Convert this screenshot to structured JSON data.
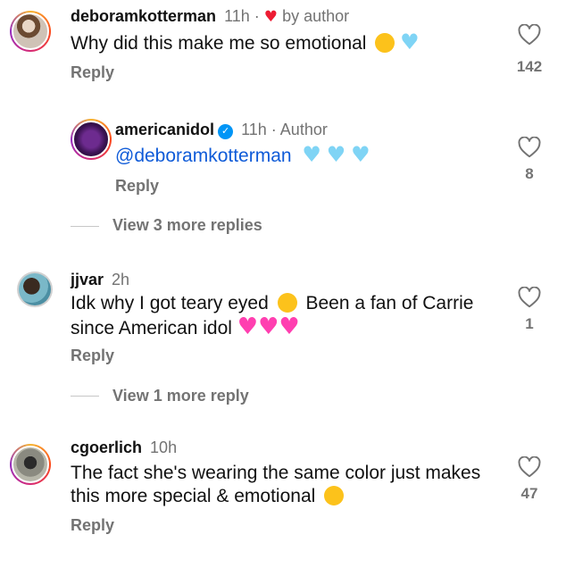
{
  "comments": [
    {
      "username": "deboramkotterman",
      "time": "11h",
      "author_tag": "by author",
      "text": "Why did this make me so emotional",
      "reply": "Reply",
      "likes": "142"
    },
    {
      "username": "americanidol",
      "time": "11h",
      "author_tag": "Author",
      "text": "@deboramkotterman",
      "reply": "Reply",
      "likes": "8",
      "verified": true
    },
    {
      "username": "jjvar",
      "time": "2h",
      "text_line1": "Idk why I got teary eyed",
      "text_line1b": "Been a fan of Carrie",
      "text_line2": "since American idol",
      "reply": "Reply",
      "likes": "1"
    },
    {
      "username": "cgoerlich",
      "time": "10h",
      "text_line1": "The fact she's wearing the same color just makes",
      "text_line2": "this more special & emotional",
      "reply": "Reply",
      "likes": "47"
    }
  ],
  "view_more": [
    "View 3 more replies",
    "View 1 more reply"
  ],
  "icons": {
    "like": "heart-outline-icon",
    "liked_by_author": "red-heart-icon"
  },
  "colors": {
    "text": "#111111",
    "muted": "#737373",
    "mention": "#0f5bd8",
    "red_heart": "#ed1c33",
    "cyan_heart": "#7fd4f5",
    "pink_heart": "#ff3fb0"
  }
}
